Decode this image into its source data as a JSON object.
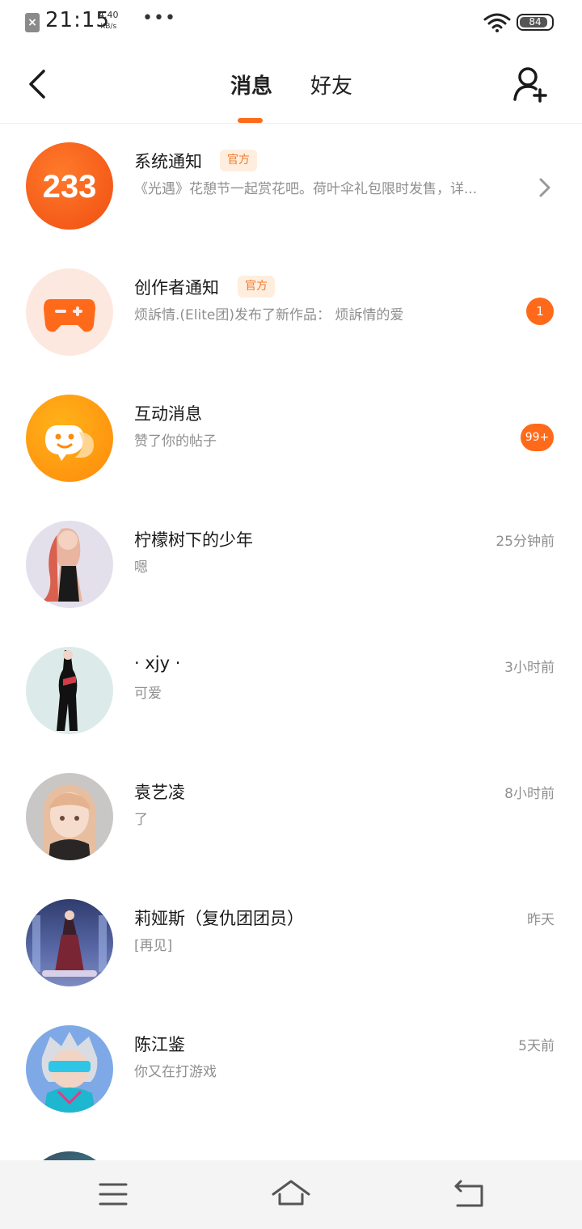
{
  "status_bar": {
    "time": "21:15",
    "net_speed_value": "4.40",
    "net_speed_unit": "KB/s",
    "more": "•••",
    "battery": "84",
    "sim_icon": "sim-off-icon",
    "wifi_icon": "wifi-icon"
  },
  "header": {
    "back_icon": "back-arrow-icon",
    "tabs": [
      {
        "label": "消息",
        "active": true
      },
      {
        "label": "好友",
        "active": false
      }
    ],
    "add_friend_icon": "add-user-icon",
    "accent_color": "#ff6a1a"
  },
  "messages": [
    {
      "name": "系统通知",
      "tag": "官方",
      "preview": "《光遇》花憩节一起赏花吧。荷叶伞礼包限时发售，详...",
      "time": "",
      "badge": "",
      "avatar_text": "233",
      "avatar_icon": "233-logo-icon",
      "trailing_icon": "chevron-right-icon"
    },
    {
      "name": "创作者通知",
      "tag": "官方",
      "preview": "烦訴情.(Elite团)发布了新作品： 烦訴情的爱",
      "time": "",
      "badge": "1",
      "avatar_icon": "gamepad-icon"
    },
    {
      "name": "互动消息",
      "tag": "",
      "preview": "赞了你的帖子",
      "time": "",
      "badge": "99+",
      "avatar_icon": "chat-bubble-face-icon"
    },
    {
      "name": "柠檬树下的少年",
      "tag": "",
      "preview": "嗯",
      "time": "25分钟前",
      "badge": "",
      "avatar_icon": "user-avatar-icon"
    },
    {
      "name": "· xjy ·",
      "tag": "",
      "preview": "可爱",
      "time": "3小时前",
      "badge": "",
      "avatar_icon": "user-avatar-icon"
    },
    {
      "name": "袁艺凌",
      "tag": "",
      "preview": "了",
      "time": "8小时前",
      "badge": "",
      "avatar_icon": "user-avatar-icon"
    },
    {
      "name": "莉娅斯（复仇团团员）",
      "tag": "",
      "preview": "[再见]",
      "time": "昨天",
      "badge": "",
      "avatar_icon": "user-avatar-icon"
    },
    {
      "name": "陈江鉴",
      "tag": "",
      "preview": "你又在打游戏",
      "time": "5天前",
      "badge": "",
      "avatar_icon": "user-avatar-icon"
    }
  ],
  "nav_bar": {
    "menu_icon": "menu-icon",
    "home_icon": "home-icon",
    "back_icon": "return-icon"
  }
}
